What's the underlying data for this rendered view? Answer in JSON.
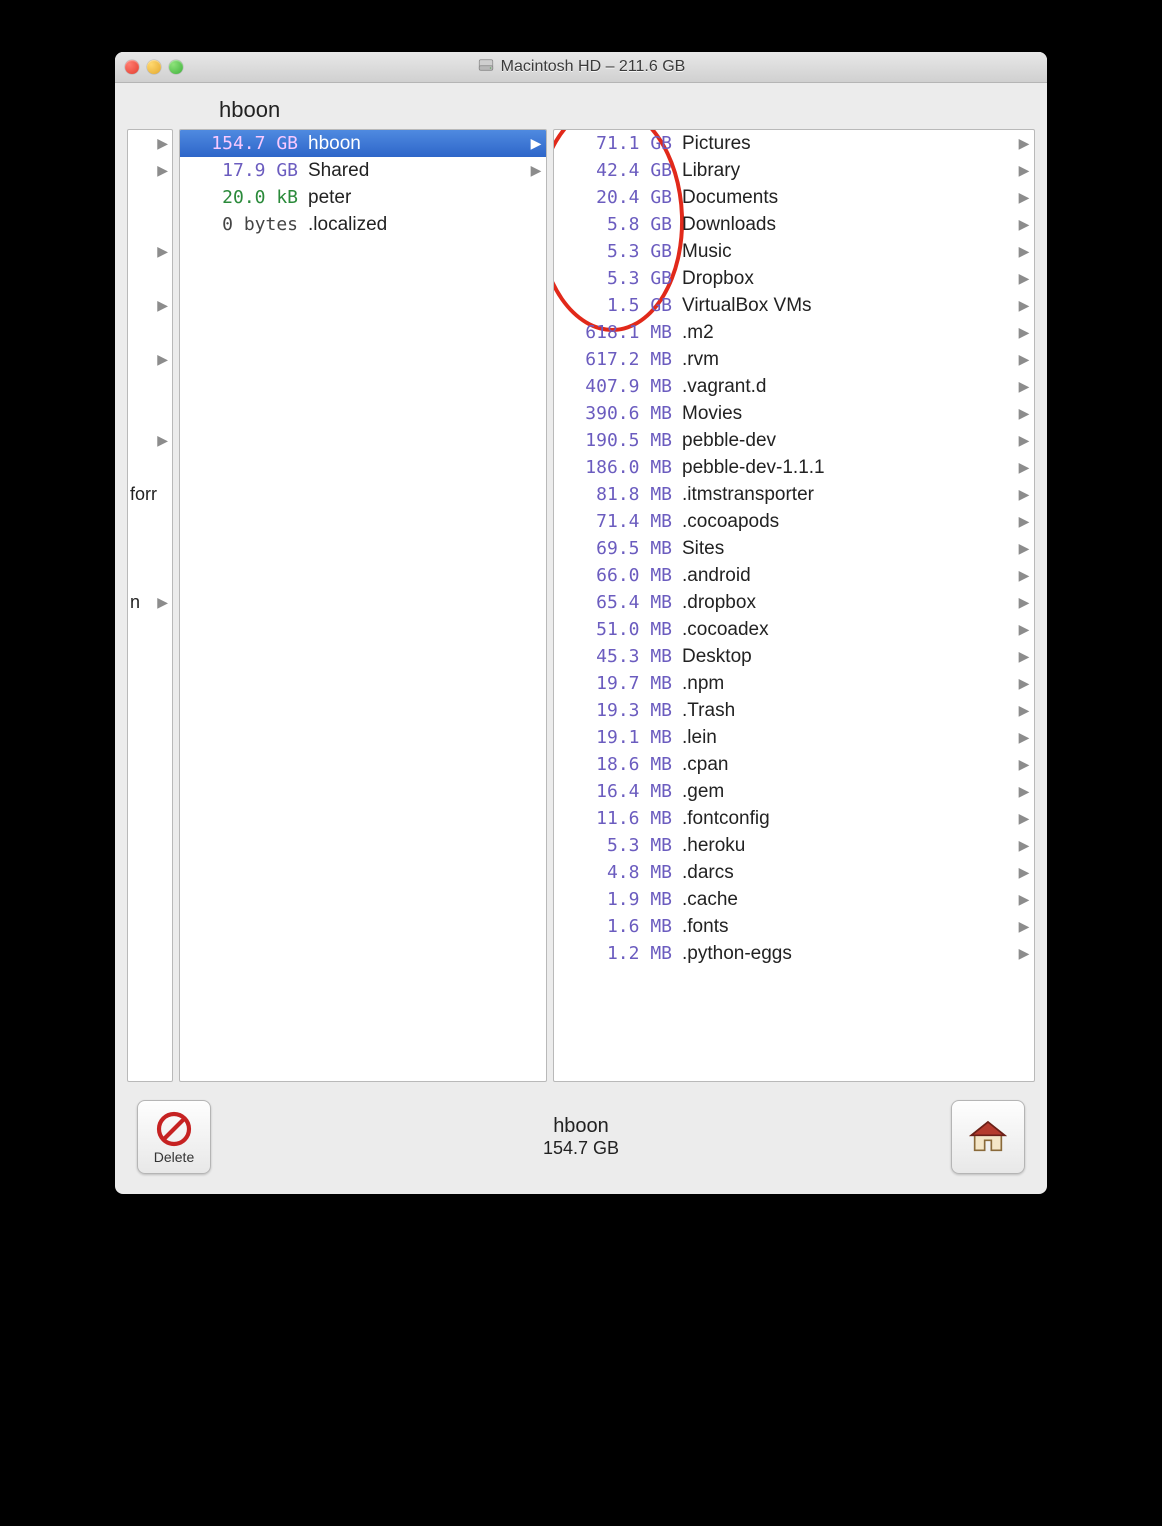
{
  "window": {
    "title": "Macintosh HD – 211.6 GB"
  },
  "path_label": "hboon",
  "col0": {
    "rows": [
      {
        "fragment": "",
        "has_arrow": true
      },
      {
        "fragment": "",
        "has_arrow": true
      },
      {
        "fragment": "",
        "has_arrow": false
      },
      {
        "fragment": "",
        "has_arrow": false
      },
      {
        "fragment": "",
        "has_arrow": true
      },
      {
        "fragment": "",
        "has_arrow": false
      },
      {
        "fragment": "",
        "has_arrow": true
      },
      {
        "fragment": "",
        "has_arrow": false
      },
      {
        "fragment": "",
        "has_arrow": true
      },
      {
        "fragment": "",
        "has_arrow": false
      },
      {
        "fragment": "",
        "has_arrow": false
      },
      {
        "fragment": "",
        "has_arrow": true
      },
      {
        "fragment": "",
        "has_arrow": false
      },
      {
        "fragment": "forr",
        "has_arrow": false
      },
      {
        "fragment": "",
        "has_arrow": false
      },
      {
        "fragment": "",
        "has_arrow": false
      },
      {
        "fragment": "",
        "has_arrow": false
      },
      {
        "fragment": "n",
        "has_arrow": true
      }
    ]
  },
  "col1": {
    "rows": [
      {
        "size": "154.7 GB",
        "name": "hboon",
        "is_folder": true,
        "selected": true,
        "size_class": ""
      },
      {
        "size": "17.9 GB",
        "name": "Shared",
        "is_folder": true,
        "selected": false,
        "size_class": ""
      },
      {
        "size": "20.0 kB",
        "name": "peter",
        "is_folder": false,
        "selected": false,
        "size_class": "green"
      },
      {
        "size": "0 bytes",
        "name": ".localized",
        "is_folder": false,
        "selected": false,
        "size_class": "bytes"
      }
    ]
  },
  "col2": {
    "rows": [
      {
        "size": "71.1 GB",
        "name": "Pictures",
        "is_folder": true
      },
      {
        "size": "42.4 GB",
        "name": "Library",
        "is_folder": true
      },
      {
        "size": "20.4 GB",
        "name": "Documents",
        "is_folder": true
      },
      {
        "size": "5.8 GB",
        "name": "Downloads",
        "is_folder": true
      },
      {
        "size": "5.3 GB",
        "name": "Music",
        "is_folder": true
      },
      {
        "size": "5.3 GB",
        "name": "Dropbox",
        "is_folder": true
      },
      {
        "size": "1.5 GB",
        "name": "VirtualBox VMs",
        "is_folder": true
      },
      {
        "size": "618.1 MB",
        "name": ".m2",
        "is_folder": true
      },
      {
        "size": "617.2 MB",
        "name": ".rvm",
        "is_folder": true
      },
      {
        "size": "407.9 MB",
        "name": ".vagrant.d",
        "is_folder": true
      },
      {
        "size": "390.6 MB",
        "name": "Movies",
        "is_folder": true
      },
      {
        "size": "190.5 MB",
        "name": "pebble-dev",
        "is_folder": true
      },
      {
        "size": "186.0 MB",
        "name": "pebble-dev-1.1.1",
        "is_folder": true
      },
      {
        "size": "81.8 MB",
        "name": ".itmstransporter",
        "is_folder": true
      },
      {
        "size": "71.4 MB",
        "name": ".cocoapods",
        "is_folder": true
      },
      {
        "size": "69.5 MB",
        "name": "Sites",
        "is_folder": true
      },
      {
        "size": "66.0 MB",
        "name": ".android",
        "is_folder": true
      },
      {
        "size": "65.4 MB",
        "name": ".dropbox",
        "is_folder": true
      },
      {
        "size": "51.0 MB",
        "name": ".cocoadex",
        "is_folder": true
      },
      {
        "size": "45.3 MB",
        "name": "Desktop",
        "is_folder": true
      },
      {
        "size": "19.7 MB",
        "name": ".npm",
        "is_folder": true
      },
      {
        "size": "19.3 MB",
        "name": ".Trash",
        "is_folder": true
      },
      {
        "size": "19.1 MB",
        "name": ".lein",
        "is_folder": true
      },
      {
        "size": "18.6 MB",
        "name": ".cpan",
        "is_folder": true
      },
      {
        "size": "16.4 MB",
        "name": ".gem",
        "is_folder": true
      },
      {
        "size": "11.6 MB",
        "name": ".fontconfig",
        "is_folder": true
      },
      {
        "size": "5.3 MB",
        "name": ".heroku",
        "is_folder": true
      },
      {
        "size": "4.8 MB",
        "name": ".darcs",
        "is_folder": true
      },
      {
        "size": "1.9 MB",
        "name": ".cache",
        "is_folder": true
      },
      {
        "size": "1.6 MB",
        "name": ".fonts",
        "is_folder": true
      },
      {
        "size": "1.2 MB",
        "name": ".python-eggs",
        "is_folder": true
      }
    ]
  },
  "footer": {
    "delete_label": "Delete",
    "selected_name": "hboon",
    "selected_size": "154.7 GB"
  }
}
